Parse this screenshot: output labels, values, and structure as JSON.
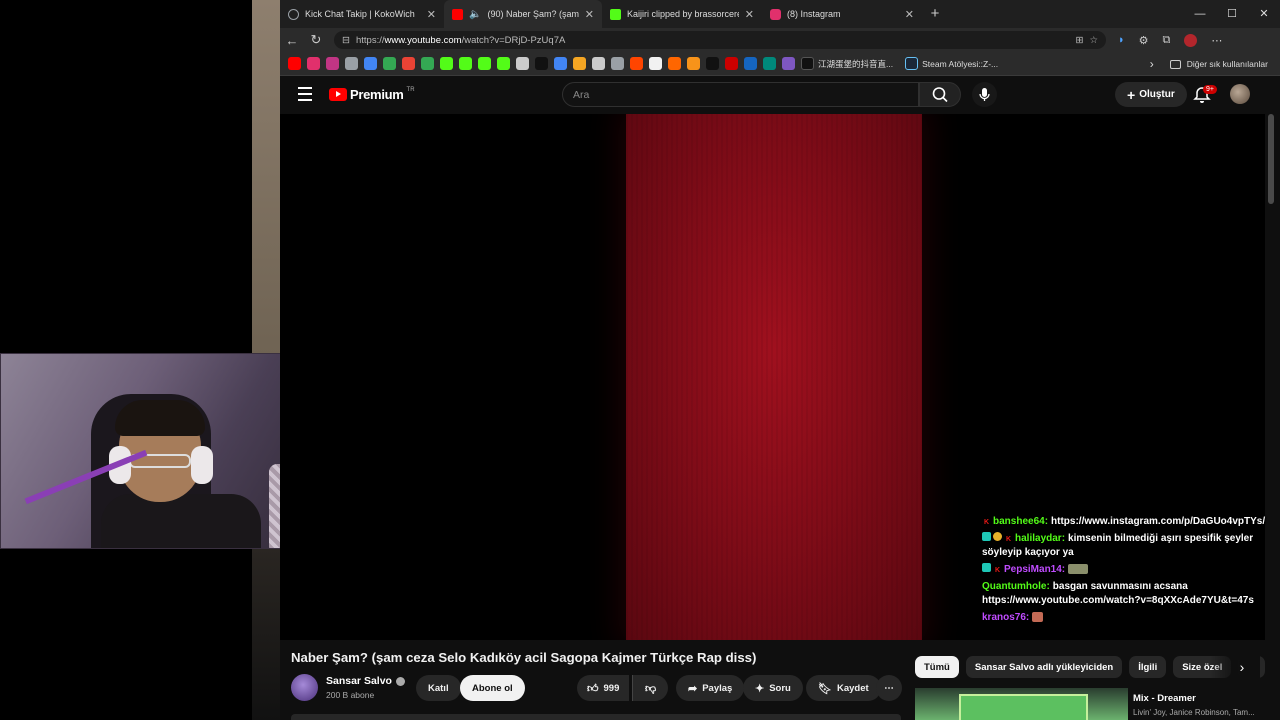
{
  "browser": {
    "tabs": [
      {
        "label": "Kick Chat Takip | KokoWich",
        "favicon_color": "#9aa0a6",
        "active": false
      },
      {
        "label": "(90) Naber Şam? (şam ceza Se",
        "favicon_color": "#ff0000",
        "active": true
      },
      {
        "label": "Kaijiri clipped by brassorcerer",
        "favicon_color": "#53fc18",
        "active": false
      },
      {
        "label": "(8) Instagram",
        "favicon_color": "#e1306c",
        "active": false
      }
    ],
    "new_tab": "+",
    "window_controls": [
      "—",
      "☐",
      "✕"
    ],
    "url_scheme": "https://",
    "url_host": "www.youtube.com",
    "url_path": "/watch?v=DRjD-PzUq7A"
  },
  "bookmarks": {
    "named": [
      {
        "label": "江湖蛋堡的抖音直...",
        "icon": "tiktok-icon",
        "color": "#111111"
      },
      {
        "label": "Steam Atölyesi::Z-...",
        "icon": "steam-icon",
        "color": "#1b2838"
      }
    ],
    "icon_colors": [
      "#ff0000",
      "#e1306c",
      "#c13584",
      "#9aa0a6",
      "#4285f4",
      "#34a853",
      "#ea4335",
      "#34a853",
      "#53fc18",
      "#53fc18",
      "#53fc18",
      "#53fc18",
      "#cccccc",
      "#111111",
      "#4285f4",
      "#f5a623",
      "#cccccc",
      "#9aa0a6",
      "#ff4500",
      "#f1f1f1",
      "#ff6600",
      "#f7931a",
      "#111111",
      "#cc0000",
      "#1565c0",
      "#00897b",
      "#7e57c2"
    ],
    "more_chevron": "›",
    "other_favorites": "Diğer sık kullanılanlar"
  },
  "youtube": {
    "logo_text": "Premium",
    "logo_region": "TR",
    "search_placeholder": "Ara",
    "create_label": "Oluştur",
    "notification_badge": "9+"
  },
  "chat": [
    {
      "user": "banshee64:",
      "text": "https://www.instagram.com/p/DaGUo4vpTYs/",
      "user_color": "#53fc18",
      "badges": [
        "kick-red"
      ]
    },
    {
      "user": "halilaydar:",
      "text": "kimsenin bilmediği aşırı spesifik şeyler söyleyip kaçıyor ya",
      "user_color": "#53fc18",
      "badges": [
        "sub",
        "gold",
        "kick-red"
      ]
    },
    {
      "user": "PepsiMan14:",
      "text": "",
      "user_color": "#c04cff",
      "badges": [
        "sub",
        "kick-red"
      ],
      "emote": "green"
    },
    {
      "user": "Quantumhole:",
      "text": "basgan savunmasını acsana https://www.youtube.com/watch?v=8qXXcAde7YU&t=47s",
      "user_color": "#53fc18",
      "badges": []
    },
    {
      "user": "kranos76:",
      "text": "",
      "user_color": "#c04cff",
      "badges": [],
      "emote": "red"
    }
  ],
  "video": {
    "title": "Naber Şam? (şam ceza Selo Kadıköy acil Sagopa Kajmer Türkçe Rap diss)",
    "channel": "Sansar Salvo",
    "subscribers": "200 B abone",
    "join_label": "Katıl",
    "subscribe_label": "Abone ol",
    "likes": "999",
    "share_label": "Paylaş",
    "ask_label": "Soru",
    "save_label": "Kaydet",
    "more": "⋯"
  },
  "related": {
    "chips": [
      "Tümü",
      "Sansar Salvo adlı yükleyiciden",
      "İlgili",
      "Size özel",
      "Sı"
    ],
    "active_chip": "Tümü",
    "next": "›",
    "first": {
      "title": "Mix - Dreamer",
      "subtitle": "Livin' Joy, Janice Robinson, Tam..."
    }
  }
}
